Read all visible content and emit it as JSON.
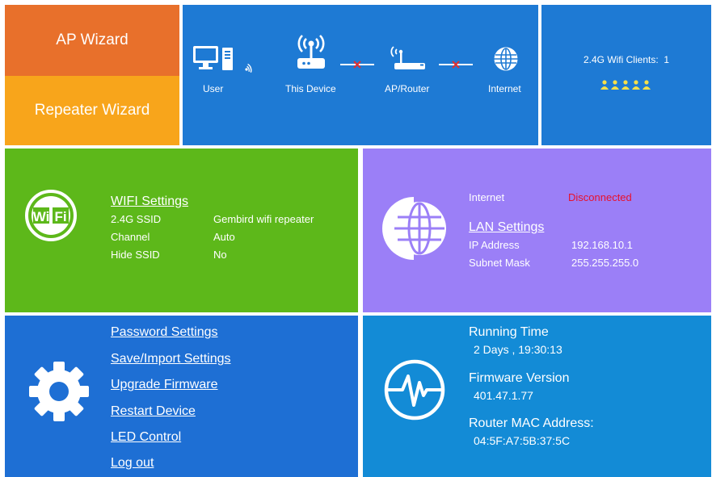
{
  "wizards": {
    "ap": "AP Wizard",
    "repeater": "Repeater Wizard"
  },
  "topology": {
    "labels": {
      "user": "User",
      "this_device": "This Device",
      "ap_router": "AP/Router",
      "internet": "Internet"
    },
    "icons": [
      "computer-icon",
      "wifi-signal-icon",
      "router-antenna-icon",
      "disconnected-link-icon",
      "ap-router-icon",
      "disconnected-link-icon",
      "globe-icon"
    ],
    "link_status_color": "#e03030"
  },
  "clients": {
    "label": "2.4G Wifi Clients:",
    "count": "1",
    "people_color": "#f5e04a"
  },
  "wifi": {
    "title": "WIFI Settings",
    "rows": [
      {
        "key": "2.4G SSID",
        "value": "Gembird wifi repeater"
      },
      {
        "key": "Channel",
        "value": "Auto"
      },
      {
        "key": "Hide SSID",
        "value": "No"
      }
    ],
    "badge_text": "Wi Fi"
  },
  "lan": {
    "internet_label": "Internet",
    "internet_status": "Disconnected",
    "internet_status_color": "#e8102b",
    "title": "LAN Settings",
    "rows": [
      {
        "key": "IP Address",
        "value": "192.168.10.1"
      },
      {
        "key": "Subnet Mask",
        "value": "255.255.255.0"
      }
    ]
  },
  "tools": {
    "links": [
      "Password Settings",
      "Save/Import Settings",
      "Upgrade Firmware",
      "Restart Device",
      "LED Control",
      "Log out"
    ]
  },
  "status": {
    "running_time_label": "Running Time",
    "running_time_value": "2 Days , 19:30:13",
    "firmware_label": "Firmware Version",
    "firmware_value": "401.47.1.77",
    "mac_label": "Router MAC Address:",
    "mac_value": "04:5F:A7:5B:37:5C"
  },
  "colors": {
    "orange": "#e8702b",
    "amber": "#f8a51b",
    "blue": "#1e7ad4",
    "green": "#5db81a",
    "purple": "#9b7ff7",
    "tools_blue": "#1e6fd4",
    "status_blue": "#138bd6"
  }
}
